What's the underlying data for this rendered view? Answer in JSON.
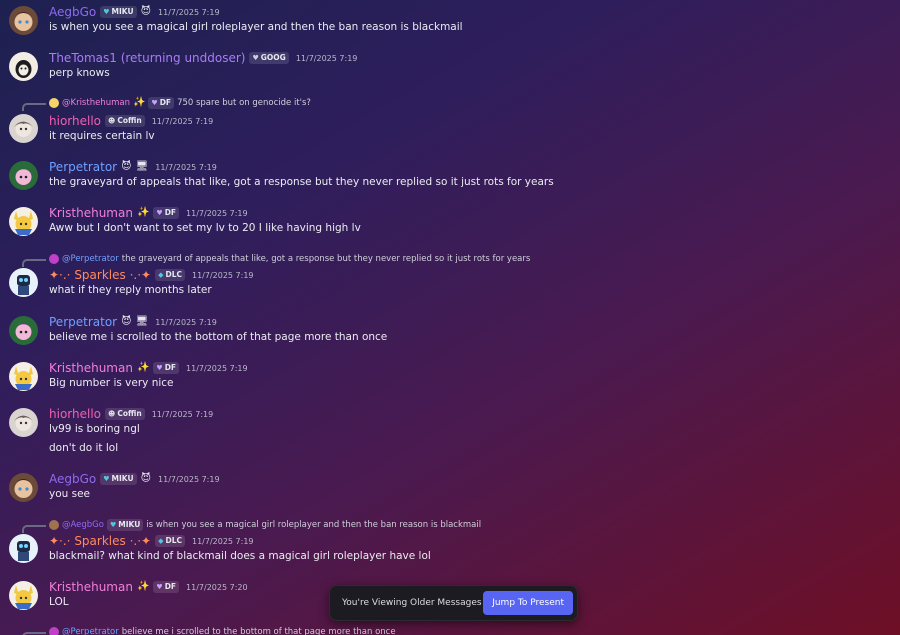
{
  "messages": [
    {
      "name": "AegbGo",
      "badge": "MIKU",
      "badge_icon": "♥",
      "icon": "😈",
      "time": "11/7/2025 7:19",
      "lines": [
        "is when you see a magical girl roleplayer and then the ban reason is blackmail"
      ]
    },
    {
      "name": "TheTomas1 (returning unddoser)",
      "badge": "GOOG",
      "badge_icon": "♥",
      "time": "11/7/2025 7:19",
      "lines": [
        "perp knows"
      ]
    },
    {
      "reply": {
        "name": "@Kristhehuman",
        "icon": "✨",
        "badge": "DF",
        "text": "750 spare but on genocide it's?"
      },
      "name": "hiorhello",
      "badge": "Coffin",
      "badge_icon": "☻",
      "time": "11/7/2025 7:19",
      "lines": [
        "it requires certain lv"
      ]
    },
    {
      "name": "Perpetrator",
      "icon": "😈",
      "icon2": "🖥",
      "time": "11/7/2025 7:19",
      "lines": [
        "the graveyard of appeals that like, got a response but they never replied so it just rots for years"
      ]
    },
    {
      "name": "Kristhehuman",
      "icon": "✨",
      "badge": "DF",
      "badge_icon": "♥",
      "time": "11/7/2025 7:19",
      "lines": [
        "Aww but I don't want to set my lv to 20 I like having high lv"
      ]
    },
    {
      "reply": {
        "name": "@Perpetrator",
        "text": "the graveyard of appeals that like, got a response but they never replied so it just rots for years"
      },
      "name": "✦⋅.⋅ Sparkles ⋅.⋅✦",
      "badge": "DLC",
      "badge_icon": "◆",
      "time": "11/7/2025 7:19",
      "lines": [
        "what if they reply months later"
      ]
    },
    {
      "name": "Perpetrator",
      "icon": "😈",
      "icon2": "🖥",
      "time": "11/7/2025 7:19",
      "lines": [
        "believe me i scrolled to the bottom of that page more than once"
      ]
    },
    {
      "name": "Kristhehuman",
      "icon": "✨",
      "badge": "DF",
      "badge_icon": "♥",
      "time": "11/7/2025 7:19",
      "lines": [
        "Big number is very nice"
      ]
    },
    {
      "name": "hiorhello",
      "badge": "Coffin",
      "badge_icon": "☻",
      "time": "11/7/2025 7:19",
      "lines": [
        "lv99 is boring ngl",
        "don't do it lol"
      ]
    },
    {
      "name": "AegbGo",
      "badge": "MIKU",
      "badge_icon": "♥",
      "icon": "😈",
      "time": "11/7/2025 7:19",
      "lines": [
        "you see"
      ]
    },
    {
      "reply": {
        "name": "@AegbGo",
        "badge": "MIKU",
        "text": "is when you see a magical girl roleplayer and then the ban reason is blackmail"
      },
      "name": "✦⋅.⋅ Sparkles ⋅.⋅✦",
      "badge": "DLC",
      "badge_icon": "◆",
      "time": "11/7/2025 7:19",
      "lines": [
        "blackmail? what kind of blackmail does a magical girl roleplayer have lol"
      ]
    },
    {
      "name": "Kristhehuman",
      "icon": "✨",
      "badge": "DF",
      "badge_icon": "♥",
      "time": "11/7/2025 7:20",
      "lines": [
        "LOL"
      ]
    },
    {
      "reply": {
        "name": "@Perpetrator",
        "text": "believe me i scrolled to the bottom of that page more than once"
      }
    }
  ],
  "toast": {
    "text": "You're Viewing Older Messages",
    "button": "Jump To Present"
  },
  "colors": {
    "aegbgo": "#8f6bf0",
    "thetomas": "#a77df5",
    "hiorhello": "#f060b0",
    "perpetrator": "#6fa0ff",
    "kristhehuman": "#f27fd8",
    "sparkles": "#ff8a5c",
    "accent": "#5865f2"
  }
}
